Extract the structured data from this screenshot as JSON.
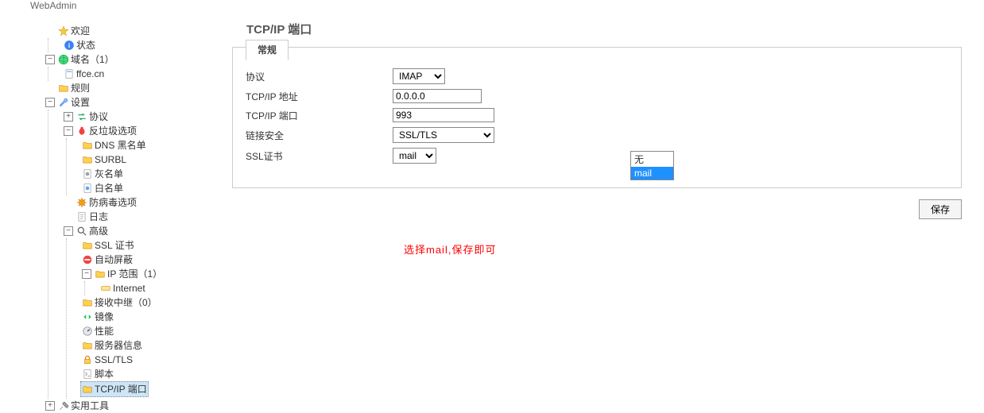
{
  "header": {
    "title": "WebAdmin"
  },
  "sidebar": {
    "welcome": "欢迎",
    "status": "状态",
    "domains": "域名（1）",
    "domain_item": "ffce.cn",
    "rules": "规则",
    "settings": "设置",
    "protocols": "协议",
    "antispam": "反垃圾选项",
    "dns_blacklist": "DNS 黑名单",
    "surbl": "SURBL",
    "greylist": "灰名单",
    "whitelist": "白名单",
    "antivirus": "防病毒选项",
    "log": "日志",
    "advanced": "高级",
    "ssl_cert": "SSL 证书",
    "auto_ban": "自动屏蔽",
    "ip_range": "IP 范围（1）",
    "internet": "Internet",
    "relay": "接收中继（0）",
    "mirror": "镜像",
    "performance": "性能",
    "server_info": "服务器信息",
    "ssl_tls": "SSL/TLS",
    "script": "脚本",
    "tcpip_port": "TCP/IP 端口",
    "utilities": "实用工具"
  },
  "page": {
    "title": "TCP/IP 端口",
    "tab": "常规",
    "labels": {
      "protocol": "协议",
      "address": "TCP/IP 地址",
      "port": "TCP/IP 端口",
      "security": "链接安全",
      "cert": "SSL证书"
    },
    "values": {
      "protocol": "IMAP",
      "address": "0.0.0.0",
      "port": "993",
      "security": "SSL/TLS",
      "cert": "mail"
    },
    "cert_options": {
      "none": "无",
      "mail": "mail"
    },
    "save": "保存",
    "hint": "选择mail,保存即可"
  }
}
